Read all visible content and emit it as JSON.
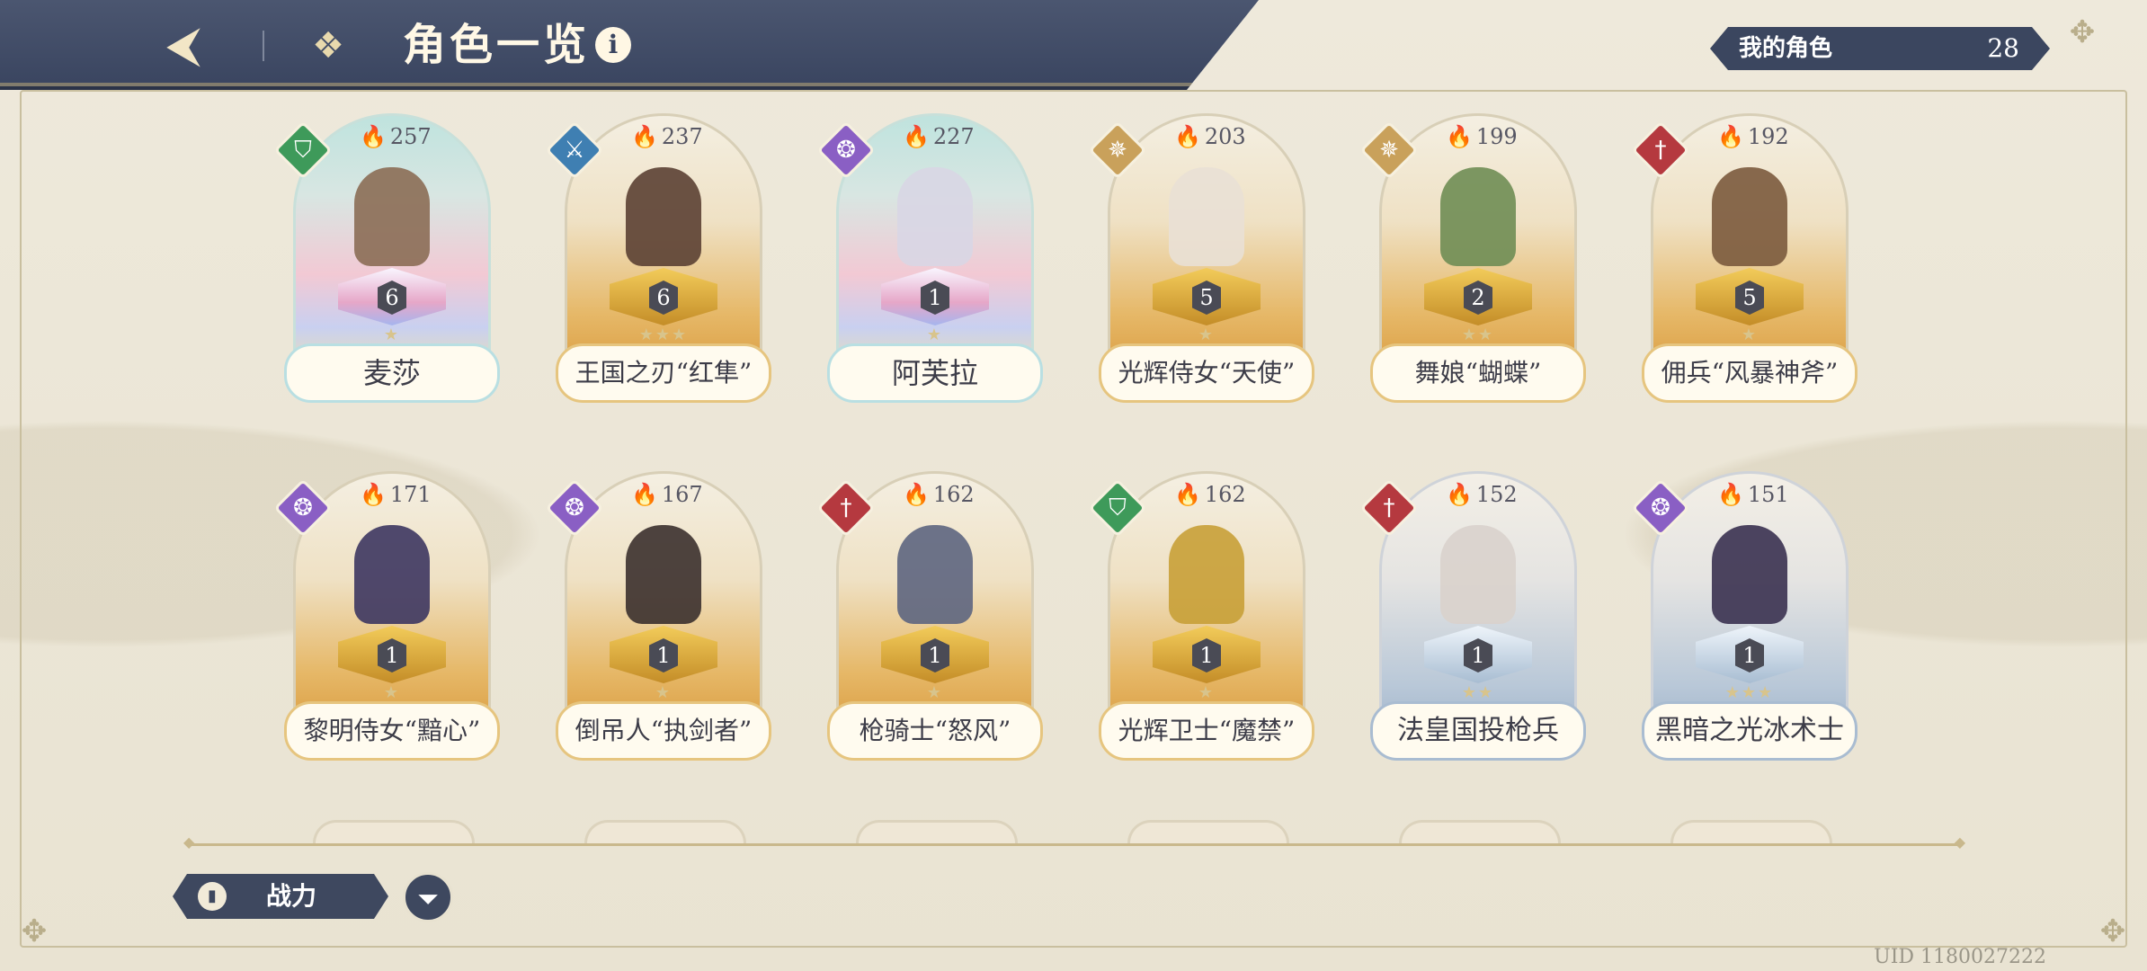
{
  "header": {
    "title": "角色一览",
    "back_icon": "back-arrow-icon",
    "menu_icon": "grid-menu-icon",
    "info_icon": "i"
  },
  "my_characters": {
    "label": "我的角色",
    "count": "28"
  },
  "characters": [
    {
      "name": "麦莎",
      "power": "257",
      "level": "6",
      "stars": "★",
      "element": "green",
      "style": "rainbow"
    },
    {
      "name": "王国之刃“红隼”",
      "power": "237",
      "level": "6",
      "stars": "★★★",
      "element": "blue",
      "style": "gold"
    },
    {
      "name": "阿芙拉",
      "power": "227",
      "level": "1",
      "stars": "★",
      "element": "purple",
      "style": "rainbow"
    },
    {
      "name": "光辉侍女“天使”",
      "power": "203",
      "level": "5",
      "stars": "★",
      "element": "gold",
      "style": "gold"
    },
    {
      "name": "舞娘“蝴蝶”",
      "power": "199",
      "level": "2",
      "stars": "★★",
      "element": "gold",
      "style": "gold"
    },
    {
      "name": "佣兵“风暴神斧”",
      "power": "192",
      "level": "5",
      "stars": "★",
      "element": "red",
      "style": "gold"
    },
    {
      "name": "黎明侍女“黯心”",
      "power": "171",
      "level": "1",
      "stars": "★",
      "element": "purple",
      "style": "gold"
    },
    {
      "name": "倒吊人“执剑者”",
      "power": "167",
      "level": "1",
      "stars": "★",
      "element": "purple",
      "style": "gold"
    },
    {
      "name": "枪骑士“怒风”",
      "power": "162",
      "level": "1",
      "stars": "★",
      "element": "red",
      "style": "gold"
    },
    {
      "name": "光辉卫士“魔禁”",
      "power": "162",
      "level": "1",
      "stars": "★",
      "element": "green",
      "style": "gold"
    },
    {
      "name": "法皇国投枪兵",
      "power": "152",
      "level": "1",
      "stars": "★★",
      "element": "red",
      "style": "silver"
    },
    {
      "name": "黑暗之光冰术士",
      "power": "151",
      "level": "1",
      "stars": "★★★",
      "element": "purple",
      "style": "silver"
    }
  ],
  "bottom": {
    "sort_label": "战力",
    "sort_icon": "bar-chart-icon",
    "filter_icon": "filter-icon",
    "uid": "UID 1180027222"
  },
  "colors": {
    "header_bg": "#3a4560",
    "accent_gold": "#e6c57f",
    "background": "#ece7d8"
  }
}
